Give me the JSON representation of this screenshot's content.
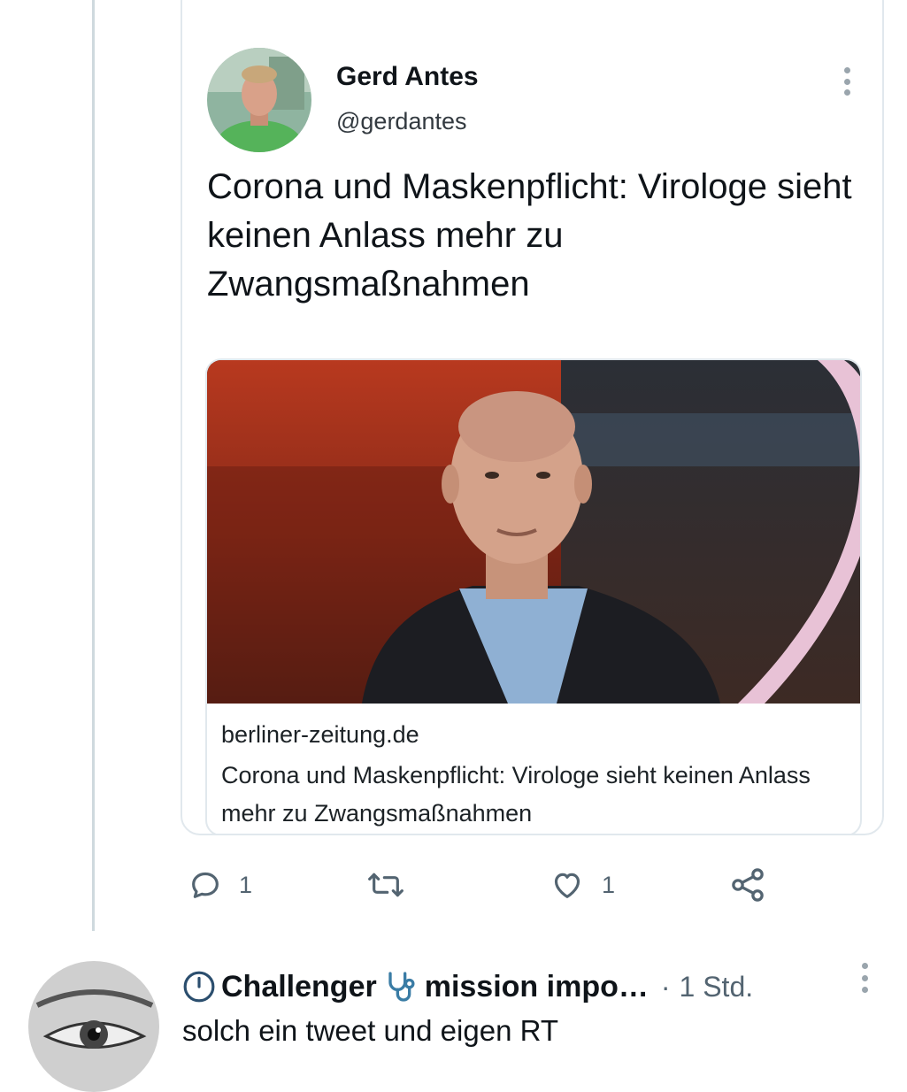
{
  "quoted_tweet": {
    "author_name": "Gerd Antes",
    "author_handle": "@gerdantes",
    "headline": "Corona und Maskenpflicht: Virologe sieht keinen Anlass mehr zu Zwangsmaßnahmen",
    "more_icon": "more-vertical-icon",
    "link_card": {
      "domain": "berliner-zeitung.de",
      "title": "Corona und Maskenpflicht: Virologe sieht keinen Anlass mehr zu Zwangsmaßnahmen"
    }
  },
  "actions": {
    "reply_icon": "reply-icon",
    "reply_count": "1",
    "retweet_icon": "retweet-icon",
    "like_icon": "heart-icon",
    "like_count": "1",
    "share_icon": "share-icon"
  },
  "reply": {
    "status_icon": "clock-icon",
    "name_part1": "Challenger",
    "name_emoji": "stethoscope-icon",
    "name_part2": "mission impo…",
    "separator": "·",
    "time": "1 Std.",
    "text": "solch ein tweet und eigen RT"
  },
  "colors": {
    "border": "#e1e8ed",
    "thread_line": "#cfd9de",
    "icon_gray": "#536471",
    "text": "#0f1419"
  }
}
